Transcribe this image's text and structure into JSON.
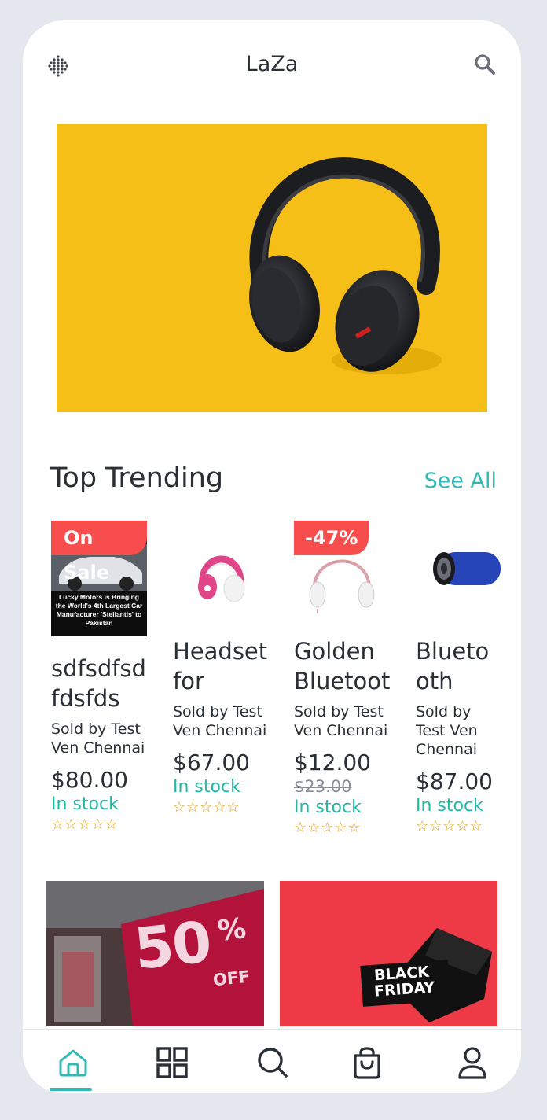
{
  "header": {
    "title": "LaZa",
    "menu_icon": "grid-dots-icon",
    "search_icon": "search-icon"
  },
  "hero": {
    "image": "yellow-headphones-banner"
  },
  "section": {
    "title": "Top Trending",
    "see_all": "See All"
  },
  "products": [
    {
      "badge": "On Sale",
      "name": "sdfsdfsdfdsfds",
      "seller": "Sold by Test Ven Chennai",
      "price": "$80.00",
      "old_price": "",
      "stock": "In stock",
      "stars": "☆☆☆☆☆",
      "thumb_text": "Lucky Motors is Bringing the World's 4th Largest Car Manufacturer 'Stellantis' to Pakistan"
    },
    {
      "badge": "",
      "name": "Headset for",
      "seller": "Sold by Test Ven Chennai",
      "price": "$67.00",
      "old_price": "",
      "stock": "In stock",
      "stars": "☆☆☆☆☆"
    },
    {
      "badge": "-47%",
      "name": "Golden Bluetoot",
      "seller": "Sold by Test Ven Chennai",
      "price": "$12.00",
      "old_price": "$23.00",
      "stock": "In stock",
      "stars": "☆☆☆☆☆"
    },
    {
      "badge": "",
      "name": "Bluetooth",
      "seller": "Sold by Test Ven Chennai",
      "price": "$87.00",
      "old_price": "",
      "stock": "In stock",
      "stars": "☆☆☆☆☆"
    }
  ],
  "promos": [
    {
      "big": "50",
      "pct": "%",
      "off": "OFF"
    },
    {
      "line1": "BLACK",
      "line2": "FRIDAY"
    }
  ],
  "nav": {
    "items": [
      "home-icon",
      "categories-icon",
      "search-icon",
      "bag-icon",
      "profile-icon"
    ],
    "active": 0
  },
  "colors": {
    "accent": "#33b9b3",
    "sale": "#f74d4d",
    "stock": "#20b8a6",
    "star": "#e0a020",
    "hero_bg": "#f6bf18"
  }
}
